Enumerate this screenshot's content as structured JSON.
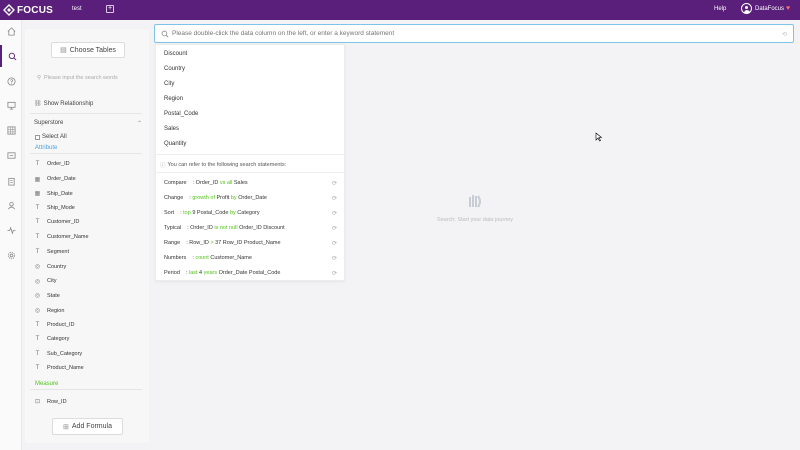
{
  "app": {
    "logo": "FOCUS",
    "tab_title": "test",
    "tab_add": "+",
    "help": "Help",
    "user": "DataFocus"
  },
  "sidebar": {
    "choose_tables": "Choose Tables",
    "search_placeholder": "Please input the search words",
    "show_relationship": "Show Relationship",
    "table_name": "Superstore",
    "select_all": "Select All",
    "attribute_label": "Attribute",
    "measure_label": "Measure",
    "attributes": [
      {
        "type": "text",
        "name": "Order_ID"
      },
      {
        "type": "date",
        "name": "Order_Date"
      },
      {
        "type": "date",
        "name": "Ship_Date"
      },
      {
        "type": "text",
        "name": "Ship_Mode"
      },
      {
        "type": "text",
        "name": "Customer_ID"
      },
      {
        "type": "text",
        "name": "Customer_Name"
      },
      {
        "type": "text",
        "name": "Segment"
      },
      {
        "type": "geo",
        "name": "Country"
      },
      {
        "type": "geo",
        "name": "City"
      },
      {
        "type": "geo",
        "name": "State"
      },
      {
        "type": "geo",
        "name": "Region"
      },
      {
        "type": "text",
        "name": "Product_ID"
      },
      {
        "type": "text",
        "name": "Category"
      },
      {
        "type": "text",
        "name": "Sub_Category"
      },
      {
        "type": "text",
        "name": "Product_Name"
      }
    ],
    "measures": [
      {
        "type": "number",
        "name": "Row_ID"
      }
    ],
    "add_formula": "Add Formula"
  },
  "search": {
    "placeholder": "Please double-click the data column on the left, or enter a keyword statement"
  },
  "dropdown": {
    "suggestions": [
      "Discount",
      "Country",
      "City",
      "Region",
      "Postal_Code",
      "Sales",
      "Quantity"
    ],
    "hint": "You can refer to the following search statements:",
    "examples": [
      {
        "label": "Compare",
        "parts": [
          {
            "t": ": Order_ID ",
            "k": false
          },
          {
            "t": "vs all",
            "k": true
          },
          {
            "t": " Sales",
            "k": false
          }
        ]
      },
      {
        "label": "Change",
        "parts": [
          {
            "t": ": ",
            "k": false
          },
          {
            "t": "growth of",
            "k": true
          },
          {
            "t": " Profit ",
            "k": false
          },
          {
            "t": "by",
            "k": true
          },
          {
            "t": " Order_Date",
            "k": false
          }
        ]
      },
      {
        "label": "Sort",
        "parts": [
          {
            "t": ": ",
            "k": false
          },
          {
            "t": "top",
            "k": true
          },
          {
            "t": " 9 Postal_Code ",
            "k": false
          },
          {
            "t": "by",
            "k": true
          },
          {
            "t": " Category",
            "k": false
          }
        ]
      },
      {
        "label": "Typical",
        "parts": [
          {
            "t": ": Order_ID ",
            "k": false
          },
          {
            "t": "is not null",
            "k": true
          },
          {
            "t": " Order_ID Discount",
            "k": false
          }
        ]
      },
      {
        "label": "Range",
        "parts": [
          {
            "t": ": Row_ID ",
            "k": false
          },
          {
            "t": ">",
            "k": true
          },
          {
            "t": " 37 Row_ID Product_Name",
            "k": false
          }
        ]
      },
      {
        "label": "Numbers",
        "parts": [
          {
            "t": ": ",
            "k": false
          },
          {
            "t": "count",
            "k": true
          },
          {
            "t": " Customer_Name",
            "k": false
          }
        ]
      },
      {
        "label": "Period",
        "parts": [
          {
            "t": ": ",
            "k": false
          },
          {
            "t": "last",
            "k": true
          },
          {
            "t": " 4 ",
            "k": false
          },
          {
            "t": "years",
            "k": true
          },
          {
            "t": " Order_Date Postal_Code",
            "k": false
          }
        ]
      }
    ]
  },
  "empty_state": {
    "text": "Search: Start your data journey"
  },
  "colors": {
    "brand": "#5a1f7a",
    "keyword": "#52c41a",
    "attribute": "#4aa3df",
    "measure": "#52c41a"
  }
}
